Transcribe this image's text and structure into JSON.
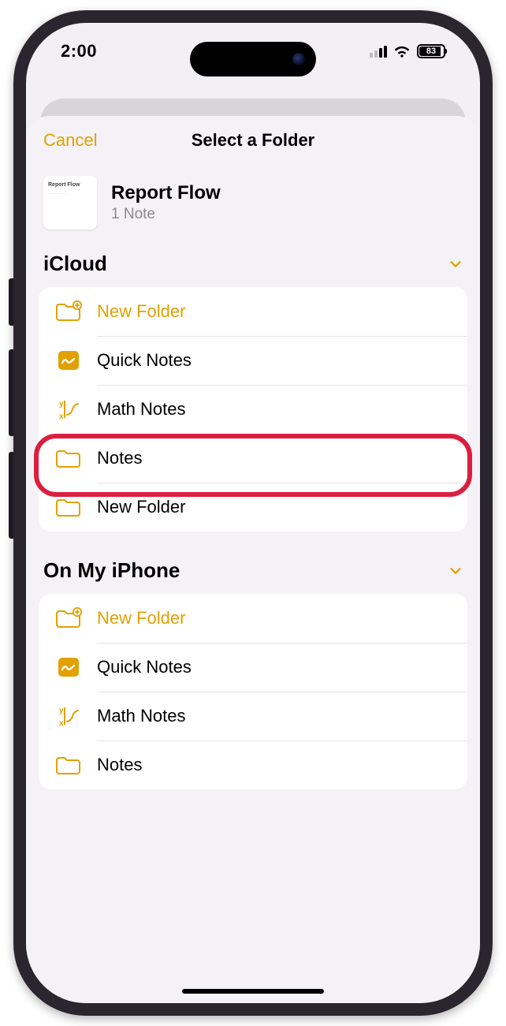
{
  "status": {
    "time": "2:00",
    "battery_percent": "83",
    "signal_active_bars": 2
  },
  "nav": {
    "cancel_label": "Cancel",
    "title": "Select a Folder"
  },
  "note": {
    "title": "Report Flow",
    "subtitle": "1 Note"
  },
  "sections": [
    {
      "id": "icloud",
      "title": "iCloud",
      "rows": [
        {
          "icon": "folder-plus",
          "label": "New Folder",
          "accent": true
        },
        {
          "icon": "quick-note",
          "label": "Quick Notes"
        },
        {
          "icon": "math",
          "label": "Math Notes"
        },
        {
          "icon": "folder",
          "label": "Notes",
          "highlighted": true
        },
        {
          "icon": "folder",
          "label": "New Folder"
        }
      ]
    },
    {
      "id": "local",
      "title": "On My iPhone",
      "rows": [
        {
          "icon": "folder-plus",
          "label": "New Folder",
          "accent": true
        },
        {
          "icon": "quick-note",
          "label": "Quick Notes"
        },
        {
          "icon": "math",
          "label": "Math Notes"
        },
        {
          "icon": "folder",
          "label": "Notes"
        }
      ]
    }
  ],
  "colors": {
    "accent": "#e2a100",
    "highlight": "#dc1f3f"
  }
}
